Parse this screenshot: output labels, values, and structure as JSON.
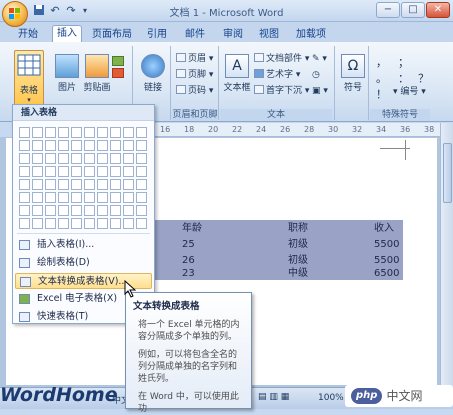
{
  "window": {
    "title": "文档 1 - Microsoft Word"
  },
  "quick_access": {
    "icons": [
      "save-icon",
      "undo-icon",
      "redo-icon"
    ]
  },
  "window_buttons": {
    "minimize": "−",
    "maximize": "□",
    "close": "✕"
  },
  "tabs": [
    {
      "label": "开始"
    },
    {
      "label": "插入"
    },
    {
      "label": "页面布局"
    },
    {
      "label": "引用"
    },
    {
      "label": "邮件"
    },
    {
      "label": "审阅"
    },
    {
      "label": "视图"
    },
    {
      "label": "加载项"
    }
  ],
  "ribbon": {
    "table_label": "表格",
    "picture_label": "图片",
    "clipart_label": "剪贴画",
    "link_label": "链接",
    "header_label": "页眉",
    "footer_label": "页脚",
    "pagenum_label": "页码",
    "header_footer_group": "页眉和页脚",
    "textbox_label": "文本框",
    "docparts_label": "文档部件",
    "wordart_label": "艺术字",
    "dropcap_label": "首字下沉",
    "text_group": "文本",
    "symbol_label": "符号",
    "special_symbol_group": "特殊符号",
    "numbering_label": "编号",
    "special_symbol_glyphs": [
      "，",
      "；",
      "。",
      "：",
      "？",
      "！"
    ]
  },
  "ruler": {
    "ticks": [
      "16",
      "18",
      "20",
      "22",
      "24",
      "26",
      "28",
      "30",
      "32",
      "34",
      "36",
      "38"
    ]
  },
  "table": {
    "headers": [
      "年龄",
      "职称",
      "收入"
    ],
    "rows": [
      [
        "25",
        "初级",
        "5500"
      ],
      [
        "26",
        "初级",
        "5500"
      ],
      [
        "23",
        "中级",
        "6500"
      ]
    ]
  },
  "dropdown": {
    "header": "插入表格",
    "items": [
      {
        "label": "插入表格(I)..."
      },
      {
        "label": "绘制表格(D)"
      },
      {
        "label": "文本转换成表格(V)..."
      },
      {
        "label": "Excel 电子表格(X)"
      },
      {
        "label": "快速表格(T)"
      }
    ]
  },
  "tooltip": {
    "title": "文本转换成表格",
    "p1": "将一个 Excel 单元格的内容分隔成多个单独的列。",
    "p2": "例如，可以将包含全名的列分隔成单独的名字列和姓氏列。",
    "p3": "在 Word 中，可以使用此功"
  },
  "statusbar": {
    "lang": "中文",
    "zoom": "100%"
  },
  "watermark": {
    "logo": "WordHome",
    "php": "php",
    "site": "中文网"
  }
}
